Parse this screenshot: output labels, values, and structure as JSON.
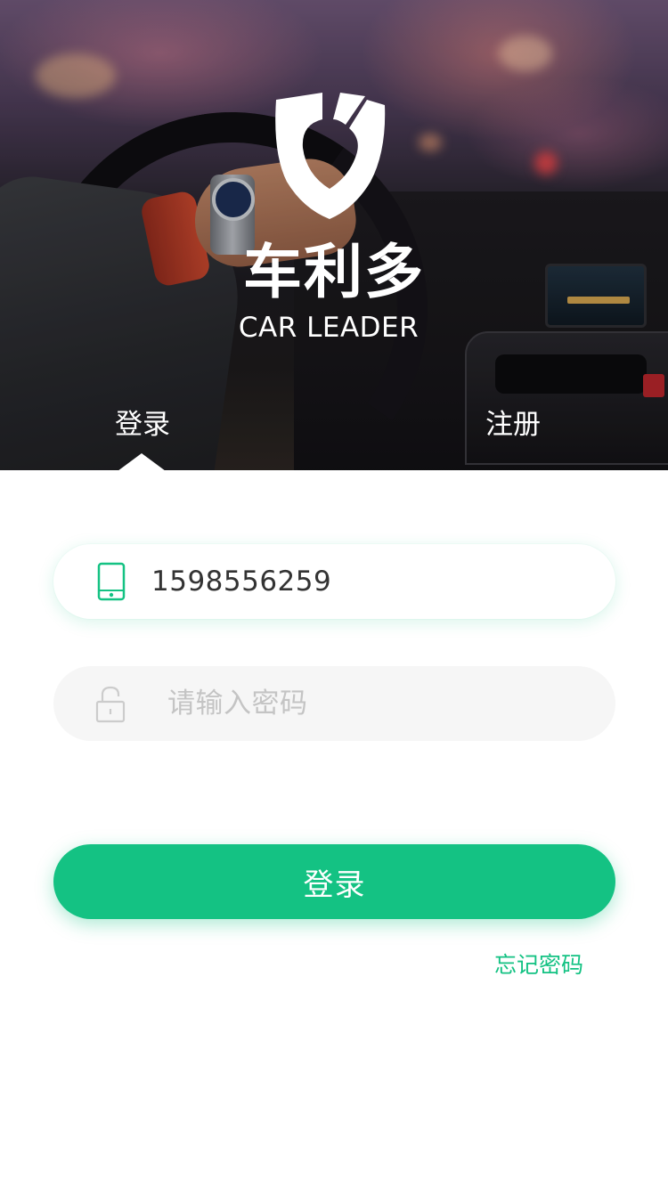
{
  "brand": {
    "name_cn": "车利多",
    "name_en": "CAR LEADER"
  },
  "tabs": {
    "login": "登录",
    "register": "注册",
    "active": "login"
  },
  "form": {
    "phone": {
      "value": "1598556259",
      "icon": "phone-icon"
    },
    "password": {
      "placeholder": "请输入密码",
      "value": "",
      "icon": "lock-icon"
    },
    "submit_label": "登录",
    "forgot_label": "忘记密码"
  },
  "colors": {
    "accent": "#14c283",
    "field_bg": "#f6f6f6",
    "placeholder": "#c4c4c4"
  }
}
